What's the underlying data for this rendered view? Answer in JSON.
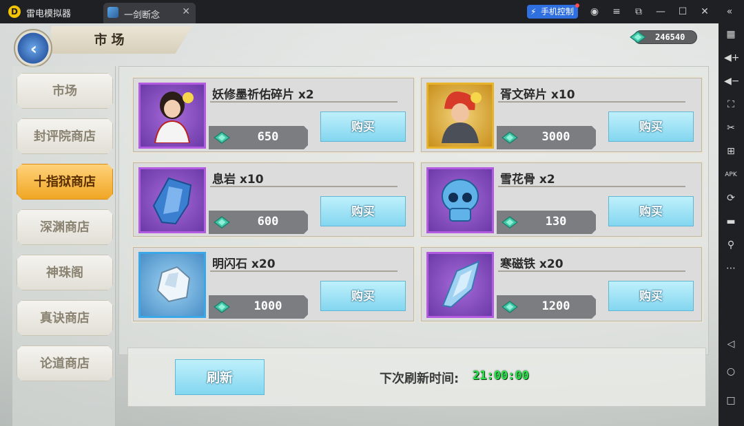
{
  "window": {
    "app_name": "雷电模拟器",
    "tab_title": "一剑断念",
    "phone_control": "手机控制"
  },
  "game": {
    "header_title": "市场",
    "currency_amount": "246540"
  },
  "sidebar": {
    "items": [
      {
        "label": "市场",
        "active": false
      },
      {
        "label": "封评院商店",
        "active": false
      },
      {
        "label": "十指狱商店",
        "active": true
      },
      {
        "label": "深渊商店",
        "active": false
      },
      {
        "label": "神珠阁",
        "active": false
      },
      {
        "label": "真诀商店",
        "active": false
      },
      {
        "label": "论道商店",
        "active": false
      }
    ]
  },
  "shop": {
    "buy_label": "购买",
    "items": [
      {
        "name": "妖修墨祈佑碎片 x2",
        "price": "650",
        "frame": "purple",
        "icon": "character-portrait-icon"
      },
      {
        "name": "胥文碎片 x10",
        "price": "3000",
        "frame": "gold",
        "icon": "warrior-portrait-icon"
      },
      {
        "name": "息岩 x10",
        "price": "600",
        "frame": "purple",
        "icon": "blue-crystal-icon"
      },
      {
        "name": "雪花骨 x2",
        "price": "130",
        "frame": "purple",
        "icon": "skull-icon"
      },
      {
        "name": "明闪石 x20",
        "price": "1000",
        "frame": "blue",
        "icon": "white-stone-icon"
      },
      {
        "name": "寒磁铁 x20",
        "price": "1200",
        "frame": "purple",
        "icon": "ice-shard-icon"
      }
    ]
  },
  "footer": {
    "refresh_label": "刷新",
    "next_refresh_label": "下次刷新时间:",
    "next_refresh_time": "21:00:00"
  }
}
